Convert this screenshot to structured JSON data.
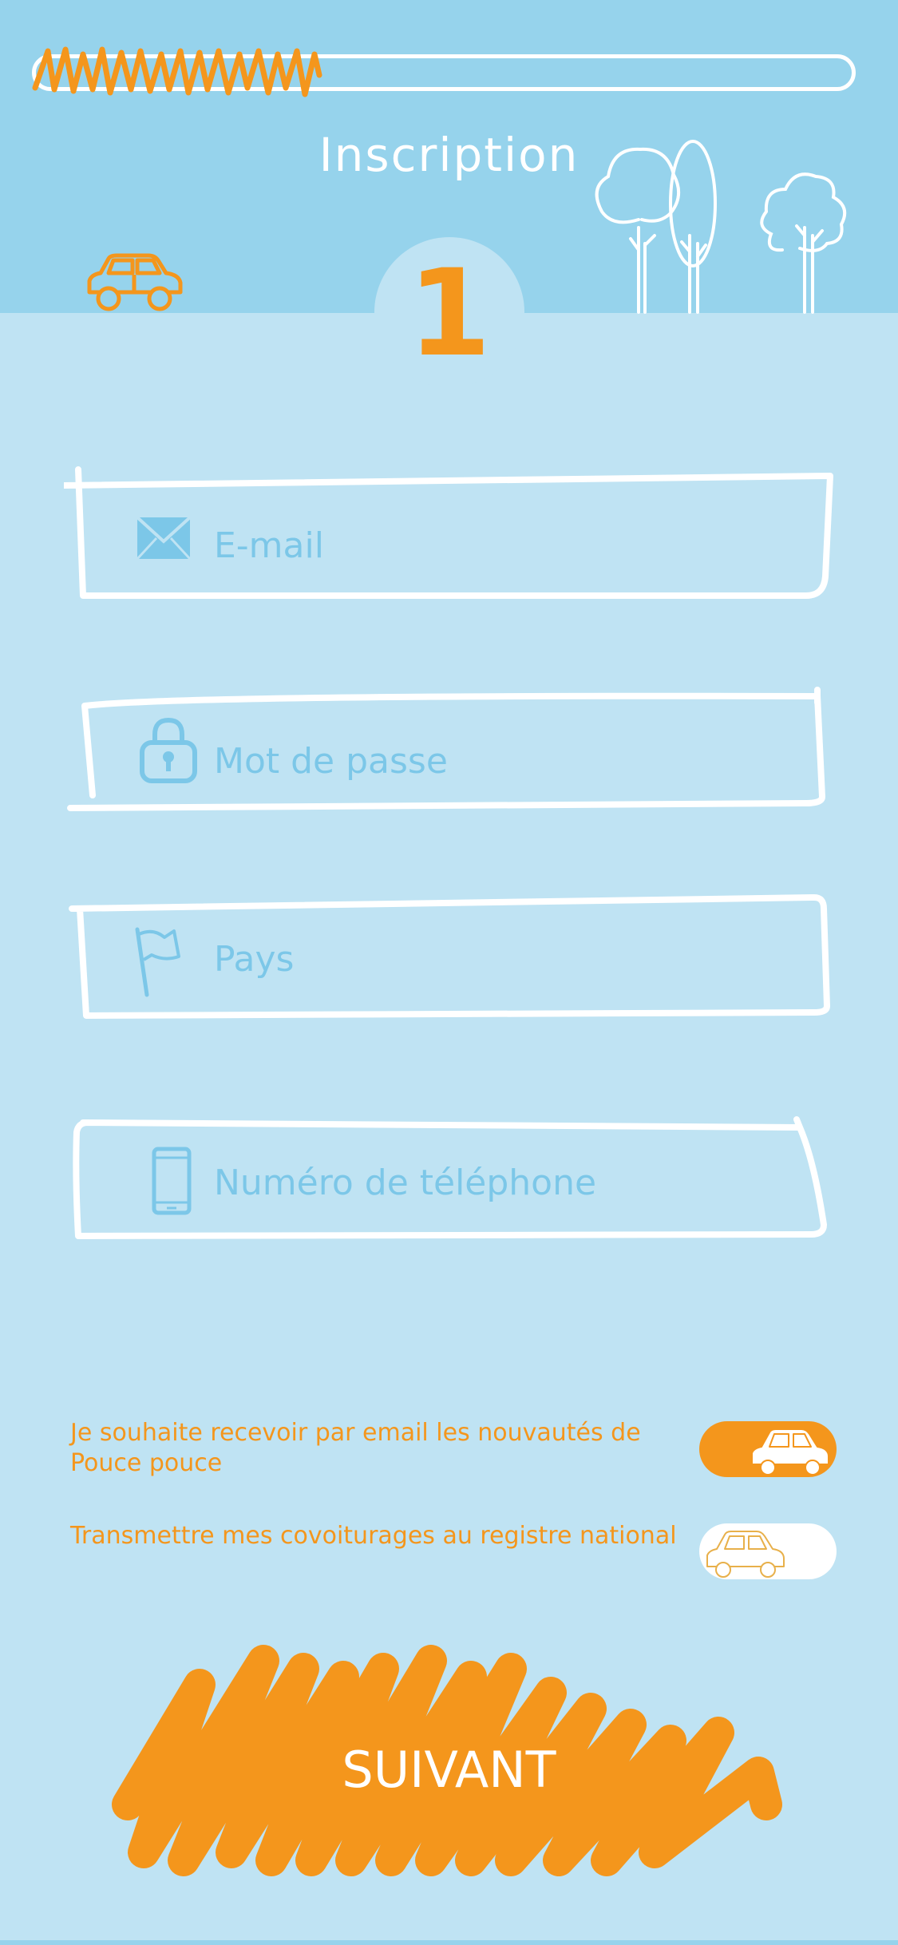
{
  "header": {
    "title": "Inscription",
    "step": "1",
    "progress": 0.35
  },
  "form": {
    "fields": [
      {
        "label": "E-mail",
        "icon": "envelope-icon"
      },
      {
        "label": "Mot de passe",
        "icon": "lock-icon"
      },
      {
        "label": "Pays",
        "icon": "flag-icon"
      },
      {
        "label": "Numéro de téléphone",
        "icon": "phone-icon"
      }
    ]
  },
  "preferences": [
    {
      "text": "Je souhaite recevoir par email les nouvautés de Pouce pouce",
      "enabled": true
    },
    {
      "text": "Transmettre mes covoiturages au registre national",
      "enabled": false
    }
  ],
  "actions": {
    "next_label": "SUIVANT"
  },
  "colors": {
    "header_bg": "#96d3ec",
    "page_bg": "#bfe3f3",
    "accent": "#f4961c",
    "field_text": "#7cc7e8"
  }
}
